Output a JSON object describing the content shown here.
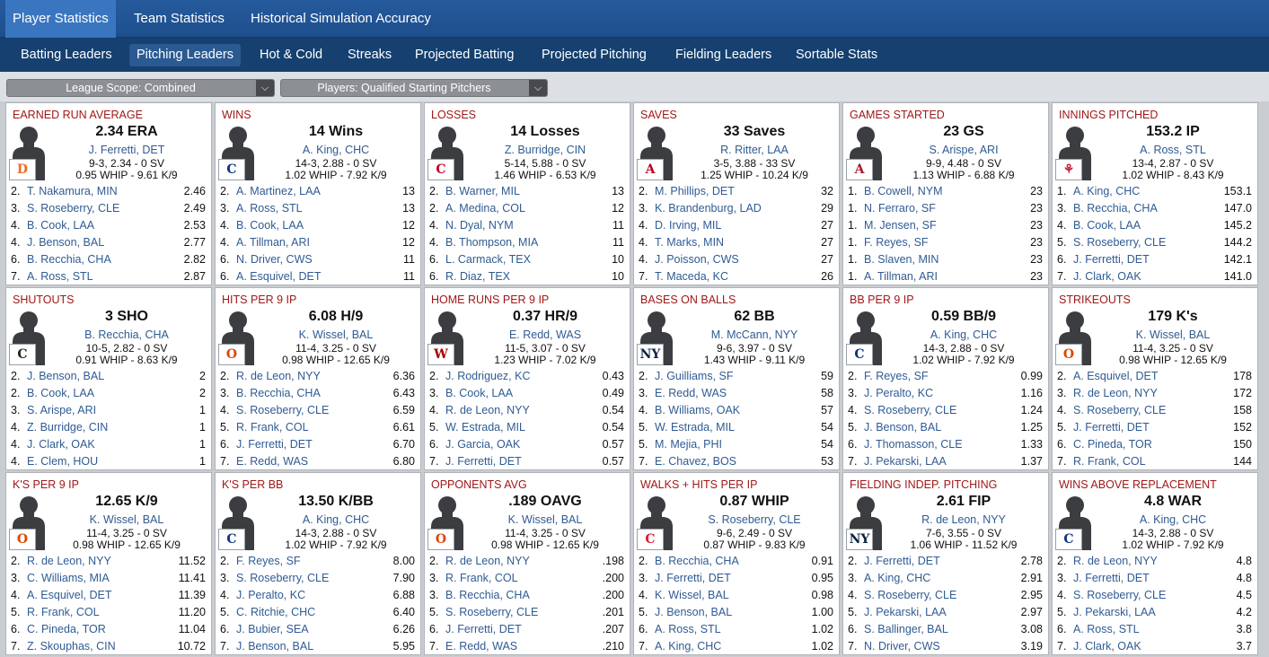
{
  "top_tabs": [
    {
      "label": "Player Statistics",
      "active": true
    },
    {
      "label": "Team Statistics",
      "active": false
    },
    {
      "label": "Historical Simulation Accuracy",
      "active": false
    }
  ],
  "sub_tabs": [
    {
      "label": "Batting Leaders",
      "active": false
    },
    {
      "label": "Pitching Leaders",
      "active": true
    },
    {
      "label": "Hot & Cold",
      "active": false
    },
    {
      "label": "Streaks",
      "active": false
    },
    {
      "label": "Projected Batting",
      "active": false
    },
    {
      "label": "Projected Pitching",
      "active": false
    },
    {
      "label": "Fielding Leaders",
      "active": false
    },
    {
      "label": "Sortable Stats",
      "active": false
    }
  ],
  "filters": {
    "league_scope": "League Scope: Combined",
    "players": "Players: Qualified Starting Pitchers"
  },
  "cards": [
    {
      "title": "EARNED RUN AVERAGE",
      "big": "2.34 ERA",
      "leader": "J. Ferretti, DET",
      "line1": "9-3, 2.34 - 0 SV",
      "line2": "0.95 WHIP - 9.61 K/9",
      "logo_icon": "tigers-logo-icon",
      "logo_glyph": "D",
      "logo_color": "#f26b21",
      "rows": [
        [
          "2.",
          "T. Nakamura, MIN",
          "2.46"
        ],
        [
          "3.",
          "S. Roseberry, CLE",
          "2.49"
        ],
        [
          "4.",
          "B. Cook, LAA",
          "2.53"
        ],
        [
          "4.",
          "J. Benson, BAL",
          "2.77"
        ],
        [
          "6.",
          "B. Recchia, CHA",
          "2.82"
        ],
        [
          "7.",
          "A. Ross, STL",
          "2.87"
        ]
      ]
    },
    {
      "title": "WINS",
      "big": "14 Wins",
      "leader": "A. King, CHC",
      "line1": "14-3, 2.88 - 0 SV",
      "line2": "1.02 WHIP - 7.92 K/9",
      "logo_icon": "cubs-logo-icon",
      "logo_glyph": "C",
      "logo_color": "#0e3386",
      "rows": [
        [
          "2.",
          "A. Martinez, LAA",
          "13"
        ],
        [
          "3.",
          "A. Ross, STL",
          "13"
        ],
        [
          "4.",
          "B. Cook, LAA",
          "12"
        ],
        [
          "4.",
          "A. Tillman, ARI",
          "12"
        ],
        [
          "6.",
          "N. Driver, CWS",
          "11"
        ],
        [
          "6.",
          "A. Esquivel, DET",
          "11"
        ]
      ]
    },
    {
      "title": "LOSSES",
      "big": "14 Losses",
      "leader": "Z. Burridge, CIN",
      "line1": "5-14, 5.88 - 0 SV",
      "line2": "1.46 WHIP - 6.53 K/9",
      "logo_icon": "reds-logo-icon",
      "logo_glyph": "C",
      "logo_color": "#c6011f",
      "rows": [
        [
          "2.",
          "B. Warner, MIL",
          "13"
        ],
        [
          "2.",
          "A. Medina, COL",
          "12"
        ],
        [
          "4.",
          "N. Dyal, NYM",
          "11"
        ],
        [
          "4.",
          "B. Thompson, MIA",
          "11"
        ],
        [
          "6.",
          "L. Carmack, TEX",
          "10"
        ],
        [
          "6.",
          "R. Diaz, TEX",
          "10"
        ]
      ]
    },
    {
      "title": "SAVES",
      "big": "33 Saves",
      "leader": "R. Ritter, LAA",
      "line1": "3-5, 3.88 - 33 SV",
      "line2": "1.25 WHIP - 10.24 K/9",
      "logo_icon": "angels-logo-icon",
      "logo_glyph": "A",
      "logo_color": "#ba0021",
      "rows": [
        [
          "2.",
          "M. Phillips, DET",
          "32"
        ],
        [
          "3.",
          "K. Brandenburg, LAD",
          "29"
        ],
        [
          "4.",
          "D. Irving, MIL",
          "27"
        ],
        [
          "4.",
          "T. Marks, MIN",
          "27"
        ],
        [
          "4.",
          "J. Poisson, CWS",
          "27"
        ],
        [
          "7.",
          "T. Maceda, KC",
          "26"
        ]
      ]
    },
    {
      "title": "GAMES STARTED",
      "big": "23 GS",
      "leader": "S. Arispe, ARI",
      "line1": "9-9, 4.48 - 0 SV",
      "line2": "1.13 WHIP - 6.88 K/9",
      "logo_icon": "diamondbacks-logo-icon",
      "logo_glyph": "A",
      "logo_color": "#a71930",
      "rows": [
        [
          "1.",
          "B. Cowell, NYM",
          "23"
        ],
        [
          "1.",
          "N. Ferraro, SF",
          "23"
        ],
        [
          "1.",
          "M. Jensen, SF",
          "23"
        ],
        [
          "1.",
          "F. Reyes, SF",
          "23"
        ],
        [
          "1.",
          "B. Slaven, MIN",
          "23"
        ],
        [
          "1.",
          "A. Tillman, ARI",
          "23"
        ]
      ]
    },
    {
      "title": "INNINGS PITCHED",
      "big": "153.2 IP",
      "leader": "A. Ross, STL",
      "line1": "13-4, 2.87 - 0 SV",
      "line2": "1.02 WHIP - 8.43 K/9",
      "logo_icon": "cardinals-logo-icon",
      "logo_glyph": "⚘",
      "logo_color": "#c41e3a",
      "rows": [
        [
          "1.",
          "A. King, CHC",
          "153.1"
        ],
        [
          "3.",
          "B. Recchia, CHA",
          "147.0"
        ],
        [
          "4.",
          "B. Cook, LAA",
          "145.2"
        ],
        [
          "5.",
          "S. Roseberry, CLE",
          "144.2"
        ],
        [
          "6.",
          "J. Ferretti, DET",
          "142.1"
        ],
        [
          "7.",
          "J. Clark, OAK",
          "141.0"
        ]
      ]
    },
    {
      "title": "SHUTOUTS",
      "big": "3 SHO",
      "leader": "B. Recchia, CHA",
      "line1": "10-5, 2.82 - 0 SV",
      "line2": "0.91 WHIP - 8.63 K/9",
      "logo_icon": "white-sox-logo-icon",
      "logo_glyph": "C",
      "logo_color": "#27251f",
      "rows": [
        [
          "2.",
          "J. Benson, BAL",
          "2"
        ],
        [
          "2.",
          "B. Cook, LAA",
          "2"
        ],
        [
          "3.",
          "S. Arispe, ARI",
          "1"
        ],
        [
          "4.",
          "Z. Burridge, CIN",
          "1"
        ],
        [
          "4.",
          "J. Clark, OAK",
          "1"
        ],
        [
          "4.",
          "E. Clem, HOU",
          "1"
        ]
      ]
    },
    {
      "title": "HITS PER 9 IP",
      "big": "6.08 H/9",
      "leader": "K. Wissel, BAL",
      "line1": "11-4, 3.25 - 0 SV",
      "line2": "0.98 WHIP - 12.65 K/9",
      "logo_icon": "orioles-logo-icon",
      "logo_glyph": "O",
      "logo_color": "#df4601",
      "rows": [
        [
          "2.",
          "R. de Leon, NYY",
          "6.36"
        ],
        [
          "3.",
          "B. Recchia, CHA",
          "6.43"
        ],
        [
          "4.",
          "S. Roseberry, CLE",
          "6.59"
        ],
        [
          "5.",
          "R. Frank, COL",
          "6.61"
        ],
        [
          "6.",
          "J. Ferretti, DET",
          "6.70"
        ],
        [
          "7.",
          "E. Redd, WAS",
          "6.80"
        ]
      ]
    },
    {
      "title": "HOME RUNS PER 9 IP",
      "big": "0.37 HR/9",
      "leader": "E. Redd, WAS",
      "line1": "11-5, 3.07 - 0 SV",
      "line2": "1.23 WHIP - 7.02 K/9",
      "logo_icon": "nationals-logo-icon",
      "logo_glyph": "W",
      "logo_color": "#ab0003",
      "rows": [
        [
          "2.",
          "J. Rodriguez, KC",
          "0.43"
        ],
        [
          "3.",
          "B. Cook, LAA",
          "0.49"
        ],
        [
          "4.",
          "R. de Leon, NYY",
          "0.54"
        ],
        [
          "5.",
          "W. Estrada, MIL",
          "0.54"
        ],
        [
          "6.",
          "J. Garcia, OAK",
          "0.57"
        ],
        [
          "7.",
          "J. Ferretti, DET",
          "0.57"
        ]
      ]
    },
    {
      "title": "BASES ON BALLS",
      "big": "62 BB",
      "leader": "M. McCann, NYY",
      "line1": "9-6, 3.97 - 0 SV",
      "line2": "1.43 WHIP - 9.11 K/9",
      "logo_icon": "yankees-logo-icon",
      "logo_glyph": "NY",
      "logo_color": "#0c2340",
      "rows": [
        [
          "2.",
          "J. Guilliams, SF",
          "59"
        ],
        [
          "3.",
          "E. Redd, WAS",
          "58"
        ],
        [
          "4.",
          "B. Williams, OAK",
          "57"
        ],
        [
          "5.",
          "W. Estrada, MIL",
          "54"
        ],
        [
          "5.",
          "M. Mejia, PHI",
          "54"
        ],
        [
          "7.",
          "E. Chavez, BOS",
          "53"
        ]
      ]
    },
    {
      "title": "BB PER 9 IP",
      "big": "0.59 BB/9",
      "leader": "A. King, CHC",
      "line1": "14-3, 2.88 - 0 SV",
      "line2": "1.02 WHIP - 7.92 K/9",
      "logo_icon": "cubs-logo-icon",
      "logo_glyph": "C",
      "logo_color": "#0e3386",
      "rows": [
        [
          "2.",
          "F. Reyes, SF",
          "0.99"
        ],
        [
          "3.",
          "J. Peralto, KC",
          "1.16"
        ],
        [
          "4.",
          "S. Roseberry, CLE",
          "1.24"
        ],
        [
          "5.",
          "J. Benson, BAL",
          "1.25"
        ],
        [
          "6.",
          "J. Thomasson, CLE",
          "1.33"
        ],
        [
          "7.",
          "J. Pekarski, LAA",
          "1.37"
        ]
      ]
    },
    {
      "title": "STRIKEOUTS",
      "big": "179 K's",
      "leader": "K. Wissel, BAL",
      "line1": "11-4, 3.25 - 0 SV",
      "line2": "0.98 WHIP - 12.65 K/9",
      "logo_icon": "orioles-logo-icon",
      "logo_glyph": "O",
      "logo_color": "#df4601",
      "rows": [
        [
          "2.",
          "A. Esquivel, DET",
          "178"
        ],
        [
          "3.",
          "R. de Leon, NYY",
          "172"
        ],
        [
          "4.",
          "S. Roseberry, CLE",
          "158"
        ],
        [
          "5.",
          "J. Ferretti, DET",
          "152"
        ],
        [
          "6.",
          "C. Pineda, TOR",
          "150"
        ],
        [
          "7.",
          "R. Frank, COL",
          "144"
        ]
      ]
    },
    {
      "title": "K'S PER 9 IP",
      "big": "12.65 K/9",
      "leader": "K. Wissel, BAL",
      "line1": "11-4, 3.25 - 0 SV",
      "line2": "0.98 WHIP - 12.65 K/9",
      "logo_icon": "orioles-logo-icon",
      "logo_glyph": "O",
      "logo_color": "#df4601",
      "rows": [
        [
          "2.",
          "R. de Leon, NYY",
          "11.52"
        ],
        [
          "3.",
          "C. Williams, MIA",
          "11.41"
        ],
        [
          "4.",
          "A. Esquivel, DET",
          "11.39"
        ],
        [
          "5.",
          "R. Frank, COL",
          "11.20"
        ],
        [
          "6.",
          "C. Pineda, TOR",
          "11.04"
        ],
        [
          "7.",
          "Z. Skouphas, CIN",
          "10.72"
        ]
      ]
    },
    {
      "title": "K'S PER BB",
      "big": "13.50 K/BB",
      "leader": "A. King, CHC",
      "line1": "14-3, 2.88 - 0 SV",
      "line2": "1.02 WHIP - 7.92 K/9",
      "logo_icon": "cubs-logo-icon",
      "logo_glyph": "C",
      "logo_color": "#0e3386",
      "rows": [
        [
          "2.",
          "F. Reyes, SF",
          "8.00"
        ],
        [
          "3.",
          "S. Roseberry, CLE",
          "7.90"
        ],
        [
          "4.",
          "J. Peralto, KC",
          "6.88"
        ],
        [
          "5.",
          "C. Ritchie, CHC",
          "6.40"
        ],
        [
          "6.",
          "J. Bubier, SEA",
          "6.26"
        ],
        [
          "7.",
          "J. Benson, BAL",
          "5.95"
        ]
      ]
    },
    {
      "title": "OPPONENTS AVG",
      "big": ".189 OAVG",
      "leader": "K. Wissel, BAL",
      "line1": "11-4, 3.25 - 0 SV",
      "line2": "0.98 WHIP - 12.65 K/9",
      "logo_icon": "orioles-logo-icon",
      "logo_glyph": "O",
      "logo_color": "#df4601",
      "rows": [
        [
          "2.",
          "R. de Leon, NYY",
          ".198"
        ],
        [
          "3.",
          "R. Frank, COL",
          ".200"
        ],
        [
          "3.",
          "B. Recchia, CHA",
          ".200"
        ],
        [
          "5.",
          "S. Roseberry, CLE",
          ".201"
        ],
        [
          "6.",
          "J. Ferretti, DET",
          ".207"
        ],
        [
          "7.",
          "E. Redd, WAS",
          ".210"
        ]
      ]
    },
    {
      "title": "WALKS + HITS PER IP",
      "big": "0.87 WHIP",
      "leader": "S. Roseberry, CLE",
      "line1": "9-6, 2.49 - 0 SV",
      "line2": "0.87 WHIP - 9.83 K/9",
      "logo_icon": "guardians-logo-icon",
      "logo_glyph": "C",
      "logo_color": "#e31937",
      "rows": [
        [
          "2.",
          "B. Recchia, CHA",
          "0.91"
        ],
        [
          "3.",
          "J. Ferretti, DET",
          "0.95"
        ],
        [
          "4.",
          "K. Wissel, BAL",
          "0.98"
        ],
        [
          "5.",
          "J. Benson, BAL",
          "1.00"
        ],
        [
          "6.",
          "A. Ross, STL",
          "1.02"
        ],
        [
          "7.",
          "A. King, CHC",
          "1.02"
        ]
      ]
    },
    {
      "title": "FIELDING INDEP. PITCHING",
      "big": "2.61 FIP",
      "leader": "R. de Leon, NYY",
      "line1": "7-6, 3.55 - 0 SV",
      "line2": "1.06 WHIP - 11.52 K/9",
      "logo_icon": "yankees-logo-icon",
      "logo_glyph": "NY",
      "logo_color": "#0c2340",
      "rows": [
        [
          "2.",
          "J. Ferretti, DET",
          "2.78"
        ],
        [
          "3.",
          "A. King, CHC",
          "2.91"
        ],
        [
          "4.",
          "S. Roseberry, CLE",
          "2.95"
        ],
        [
          "5.",
          "J. Pekarski, LAA",
          "2.97"
        ],
        [
          "6.",
          "S. Ballinger, BAL",
          "3.08"
        ],
        [
          "7.",
          "N. Driver, CWS",
          "3.19"
        ]
      ]
    },
    {
      "title": "WINS ABOVE REPLACEMENT",
      "big": "4.8 WAR",
      "leader": "A. King, CHC",
      "line1": "14-3, 2.88 - 0 SV",
      "line2": "1.02 WHIP - 7.92 K/9",
      "logo_icon": "cubs-logo-icon",
      "logo_glyph": "C",
      "logo_color": "#0e3386",
      "rows": [
        [
          "2.",
          "R. de Leon, NYY",
          "4.8"
        ],
        [
          "3.",
          "J. Ferretti, DET",
          "4.8"
        ],
        [
          "4.",
          "S. Roseberry, CLE",
          "4.5"
        ],
        [
          "5.",
          "J. Pekarski, LAA",
          "4.2"
        ],
        [
          "6.",
          "A. Ross, STL",
          "3.8"
        ],
        [
          "7.",
          "J. Clark, OAK",
          "3.7"
        ]
      ]
    }
  ]
}
